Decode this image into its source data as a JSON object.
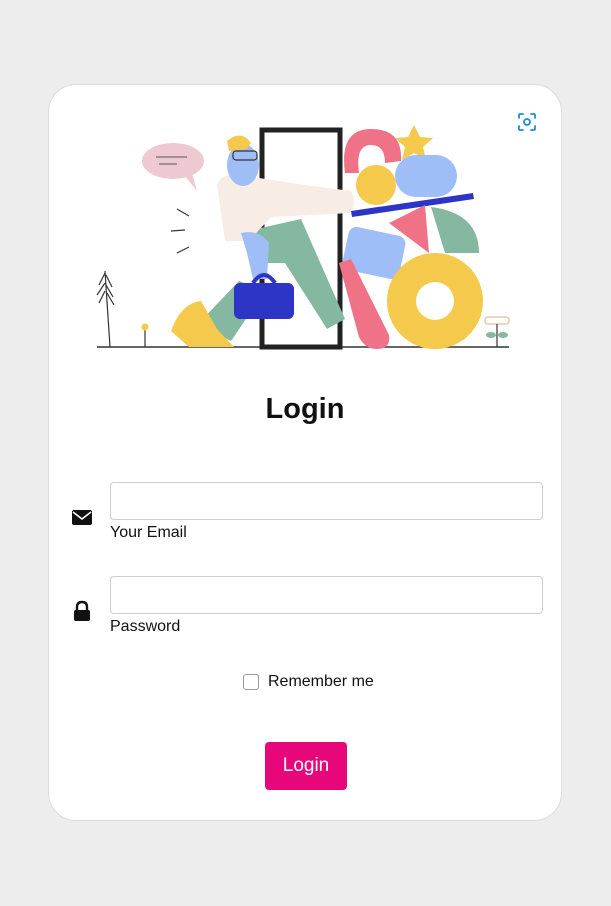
{
  "login_form": {
    "title": "Login",
    "email": {
      "label": "Your Email",
      "value": "",
      "icon": "envelope-icon"
    },
    "password": {
      "label": "Password",
      "value": "",
      "icon": "lock-icon"
    },
    "remember": {
      "label": "Remember me",
      "checked": false
    },
    "submit_label": "Login"
  },
  "colors": {
    "accent": "#e8077b",
    "scan_icon": "#1a8fd6",
    "page_background": "#ededed",
    "card_background": "#ffffff"
  },
  "icons": [
    "scan-icon",
    "envelope-icon",
    "lock-icon"
  ]
}
